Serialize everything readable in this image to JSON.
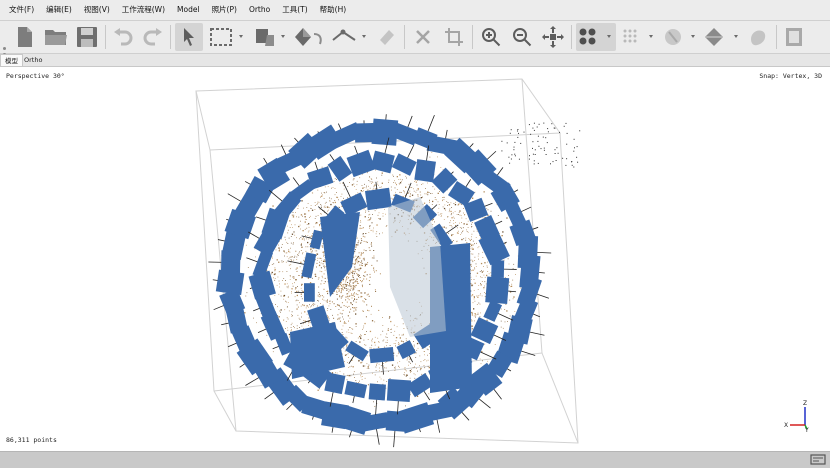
{
  "menu": {
    "items": [
      "文件(F)",
      "编辑(E)",
      "视图(V)",
      "工作流程(W)",
      "Model",
      "照片(P)",
      "Ortho",
      "工具(T)",
      "帮助(H)"
    ]
  },
  "toolbar": {
    "buttons": [
      "new-document",
      "open-folder",
      "save",
      "undo",
      "redo",
      "navigation-select",
      "rectangle-selection",
      "pan",
      "rotate",
      "ruler-measure",
      "draw-line",
      "delete",
      "crop",
      "zoom-in",
      "zoom-out",
      "reset-view",
      "show-cameras",
      "show-thumbnails",
      "shading-solid",
      "shading-textured",
      "show-mask",
      "capture-view"
    ]
  },
  "tabs": [
    "模型",
    "Ortho"
  ],
  "viewport": {
    "projection_label": "Perspective 30°",
    "snap_label": "Snap: Vertex, 3D",
    "point_count": "86,311 points",
    "axes": {
      "x": "X",
      "y": "Y",
      "z": "Z"
    }
  },
  "colors": {
    "camera_blue": "#3a6aab",
    "point_brown": "#a8814f",
    "axis_red": "#d42020",
    "axis_blue": "#2030c8",
    "axis_green": "#20a030"
  }
}
